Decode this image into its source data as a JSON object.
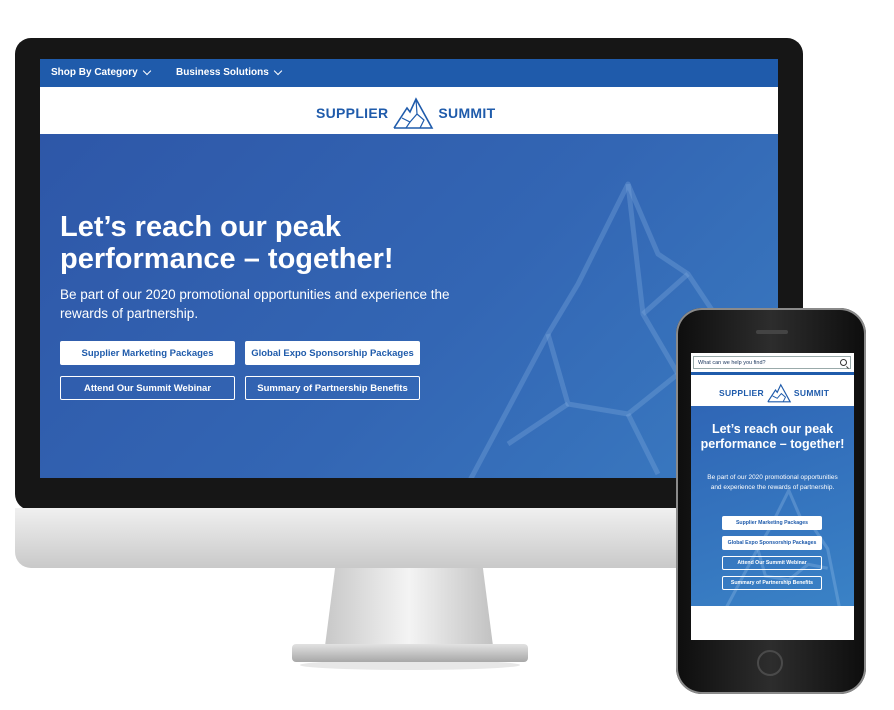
{
  "desktop": {
    "nav": {
      "items": [
        "Shop By Category",
        "Business Solutions"
      ]
    },
    "logo": {
      "left": "SUPPLIER",
      "right": "SUMMIT",
      "icon": "mountain-icon"
    },
    "hero": {
      "headline": "Let’s reach our peak performance – together!",
      "subtext": "Be part of our 2020 promotional opportunities and experience the rewards of partnership.",
      "buttons": [
        "Supplier Marketing Packages",
        "Global Expo Sponsorship Packages",
        "Attend Our Summit Webinar",
        "Summary of Partnership Benefits"
      ]
    }
  },
  "mobile": {
    "search": {
      "placeholder": "What can we help you find?",
      "icon": "search-icon"
    },
    "logo": {
      "left": "SUPPLIER",
      "right": "SUMMIT",
      "icon": "mountain-icon"
    },
    "hero": {
      "headline": "Let’s reach our peak performance – together!",
      "subtext": "Be part of our 2020 promotional opportunities and experience the rewards of partnership.",
      "buttons": [
        "Supplier Marketing Packages",
        "Global Expo Sponsorship Packages",
        "Attend Our Summit Webinar",
        "Summary of Partnership Benefits"
      ]
    }
  },
  "colors": {
    "brand_blue": "#1f5bab",
    "hero_blue": "#3366b4",
    "button_text": "#1f5bab",
    "white": "#ffffff"
  }
}
